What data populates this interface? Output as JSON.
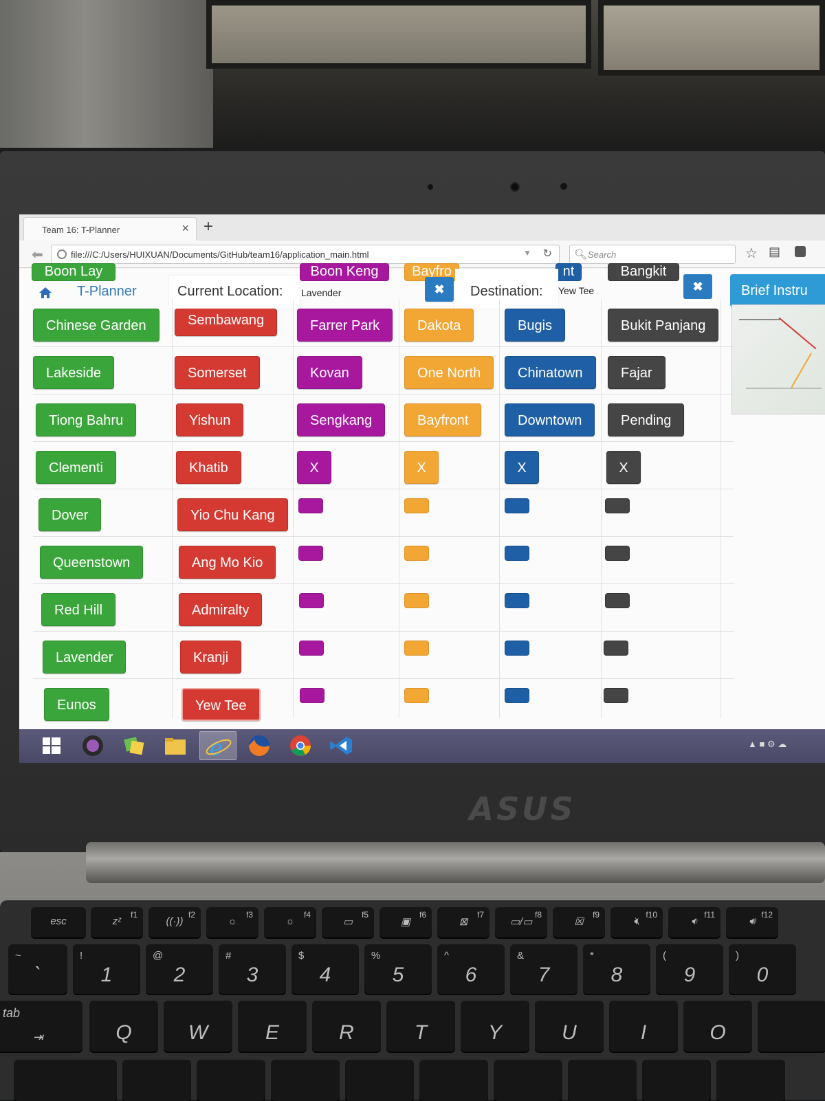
{
  "browser": {
    "tab_title": "Team 16: T-Planner",
    "tab_close": "×",
    "new_tab": "+",
    "url": "file:///C:/Users/HUIXUAN/Documents/GitHub/team16/application_main.html",
    "search_placeholder": "Search"
  },
  "header": {
    "brand": "T-Planner",
    "current_location_label": "Current Location:",
    "current_location_value": "Lavender",
    "destination_label": "Destination:",
    "destination_value": "Yew Tee",
    "clear_icon": "✖",
    "brief_button": "Brief Instru",
    "clipped_top": [
      "Boon Lay",
      "Boon Keng",
      "Bayfro",
      "nt",
      "Bangkit"
    ]
  },
  "columns": {
    "green": [
      "Chinese Garden",
      "Lakeside",
      "Tiong Bahru",
      "Clementi",
      "Dover",
      "Queenstown",
      "Red Hill",
      "Lavender",
      "Eunos"
    ],
    "red": [
      "Sembawang",
      "Somerset",
      "Yishun",
      "Khatib",
      "Yio Chu Kang",
      "Ang Mo Kio",
      "Admiralty",
      "Kranji",
      "Yew Tee"
    ],
    "purple": [
      "Farrer Park",
      "Kovan",
      "Sengkang",
      "X"
    ],
    "orange": [
      "Dakota",
      "One North",
      "Bayfront",
      "X"
    ],
    "blue": [
      "Bugis",
      "Chinatown",
      "Downtown",
      "X"
    ],
    "dark": [
      "Bukit Panjang",
      "Fajar",
      "Pending",
      "X"
    ]
  },
  "colors": {
    "green": "#3aa53a",
    "red": "#d43a32",
    "purple": "#a8189f",
    "orange": "#f2a633",
    "blue": "#1f5fa5",
    "dark": "#454545",
    "accent": "#2e9bd6"
  },
  "laptop": {
    "brand": "ASUS",
    "fn_keys": [
      "esc",
      "f1",
      "f2",
      "f3",
      "f4",
      "f5",
      "f6",
      "f7",
      "f8",
      "f9",
      "f10",
      "f11",
      "f12"
    ],
    "num_keys": [
      {
        "main": "1",
        "sub": "!"
      },
      {
        "main": "2",
        "sub": "@"
      },
      {
        "main": "3",
        "sub": "#"
      },
      {
        "main": "4",
        "sub": "$"
      },
      {
        "main": "5",
        "sub": "%"
      },
      {
        "main": "6",
        "sub": "^"
      },
      {
        "main": "7",
        "sub": "&"
      },
      {
        "main": "8",
        "sub": "*"
      },
      {
        "main": "9",
        "sub": "("
      },
      {
        "main": "0",
        "sub": ")"
      }
    ],
    "letter_keys": [
      "Q",
      "W",
      "E",
      "R",
      "T",
      "Y",
      "U",
      "I",
      "O"
    ],
    "tab_key": "tab"
  },
  "taskbar": {
    "icons": [
      "windows-start-icon",
      "github-icon",
      "sticky-notes-icon",
      "file-explorer-icon",
      "internet-explorer-icon",
      "firefox-icon",
      "chrome-icon",
      "visual-studio-code-icon"
    ]
  }
}
